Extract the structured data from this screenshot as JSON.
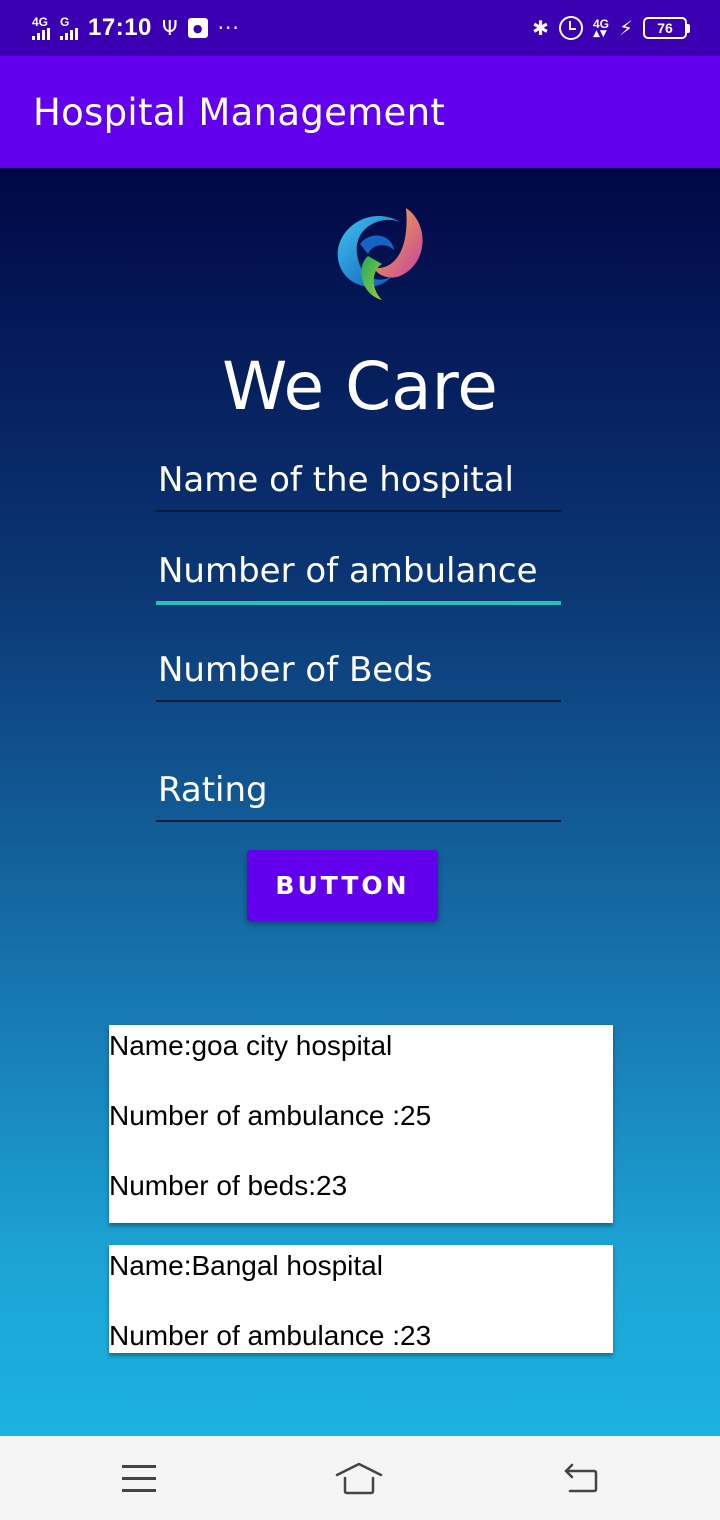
{
  "status_bar": {
    "network_1": "4G",
    "network_2": "G",
    "time": "17:10",
    "network_3": "4G",
    "battery_level": "76",
    "icons": [
      "signal-icon",
      "usb-icon",
      "notification-icon",
      "more-icon",
      "bluetooth-icon",
      "alarm-icon",
      "data-icon",
      "charging-icon",
      "battery-icon"
    ]
  },
  "app_bar": {
    "title": "Hospital Management",
    "color": "#6200ee"
  },
  "main": {
    "logo_icon": "swirl-logo-icon",
    "heading": "We Care",
    "fields": {
      "name_placeholder": "Name of the hospital",
      "ambulance_placeholder": "Number of ambulance",
      "beds_placeholder": "Number of Beds",
      "rating_placeholder": "Rating"
    },
    "button_label": "BUTTON",
    "cards": [
      {
        "name": "Name:goa city hospital",
        "ambulance": "Number of ambulance :25",
        "beds": "Number of beds:23"
      },
      {
        "name": "Name:Bangal hospital",
        "ambulance": "Number of ambulance :23"
      }
    ]
  },
  "nav_bar": {
    "icons": [
      "menu-icon",
      "home-icon",
      "back-icon"
    ]
  },
  "colors": {
    "status_bar": "#3a00b2",
    "accent": "#26c2b6",
    "gradient_top": "#010746",
    "gradient_bottom": "#1cb2e0"
  }
}
